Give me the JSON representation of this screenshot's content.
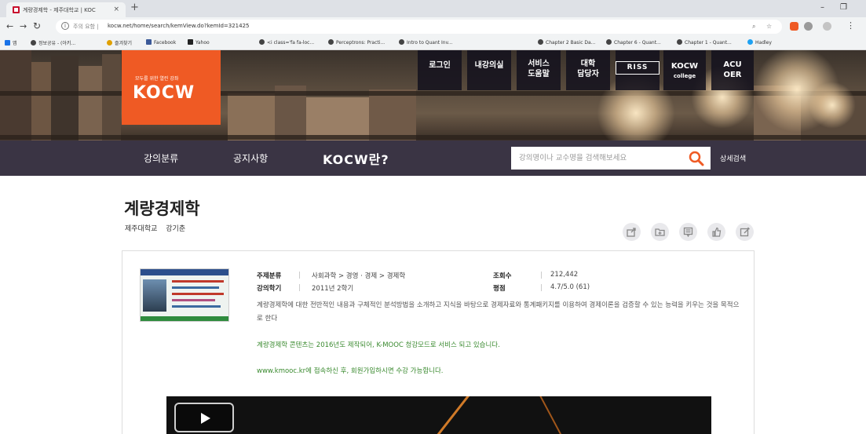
{
  "browser": {
    "tab_title": "계량경제학 - 제주대학교 | KOC",
    "tab_close": "×",
    "new_tab": "+",
    "window_minimize": "–",
    "window_maximize": "❐",
    "url_prefix": "주의 요함 |",
    "url": "kocw.net/home/search/kemView.do?kemId=321425",
    "bookmarks": [
      "앱",
      "정보공유 - (아키...",
      "즐겨찾기",
      "Facebook",
      "Yahoo",
      "<i class='fa fa-loc...",
      "Perceptrons: Practi...",
      "Intro to Quant Inv...",
      "Chapter 2 Basic Da...",
      "Chapter 6 - Quant...",
      "Chapter 1 - Quant...",
      "Hadley"
    ]
  },
  "site": {
    "logo_tagline": "모두를 위한 열린 강좌",
    "logo_word": "KOCW",
    "top_nav": {
      "login": "로그인",
      "my_lecture_1": "내강의실",
      "service_1": "서비스",
      "service_2": "도움말",
      "univ_1": "대학",
      "univ_2": "담당자",
      "riss": "RISS",
      "kocw_college_1": "KOCW",
      "kocw_college_2": "college",
      "acu_1": "ACU",
      "acu_2": "OER"
    },
    "main_nav": {
      "category": "강의분류",
      "notice": "공지사항",
      "what_is": "KOCW란?"
    },
    "search": {
      "placeholder": "강의명이나 교수명을 검색해보세요",
      "advanced": "상세검색"
    }
  },
  "course": {
    "title": "계량경제학",
    "university": "제주대학교",
    "professor": "강기춘",
    "subject_label": "주제분류",
    "subject_value": "사회과학 > 경영 · 경제 > 경제학",
    "semester_label": "강의학기",
    "semester_value": "2011년 2학기",
    "views_label": "조회수",
    "views_value": "212,442",
    "rating_label": "평점",
    "rating_value": "4.7/5.0 (61)",
    "description": "계량경제학에 대한 전반적인 내용과 구체적인 분석방법을 소개하고 지식을 바탕으로 경제자료와 통계패키지를 이용하여 경제이론을 검증할 수 있는 능력을 키우는 것을 목적으로 한다",
    "notice_1": "계량경제학 콘텐츠는 2016년도 제작되어, K-MOOC 청강모드로 서비스 되고 있습니다.",
    "notice_2": "www.kmooc.kr에 접속하신 후, 회원가입하시면 수강 가능합니다."
  },
  "colors": {
    "brand_orange": "#ef5a24",
    "nav_purple": "#3a3444",
    "notice_green": "#3a8a2f",
    "search_icon": "#ef5a24"
  }
}
